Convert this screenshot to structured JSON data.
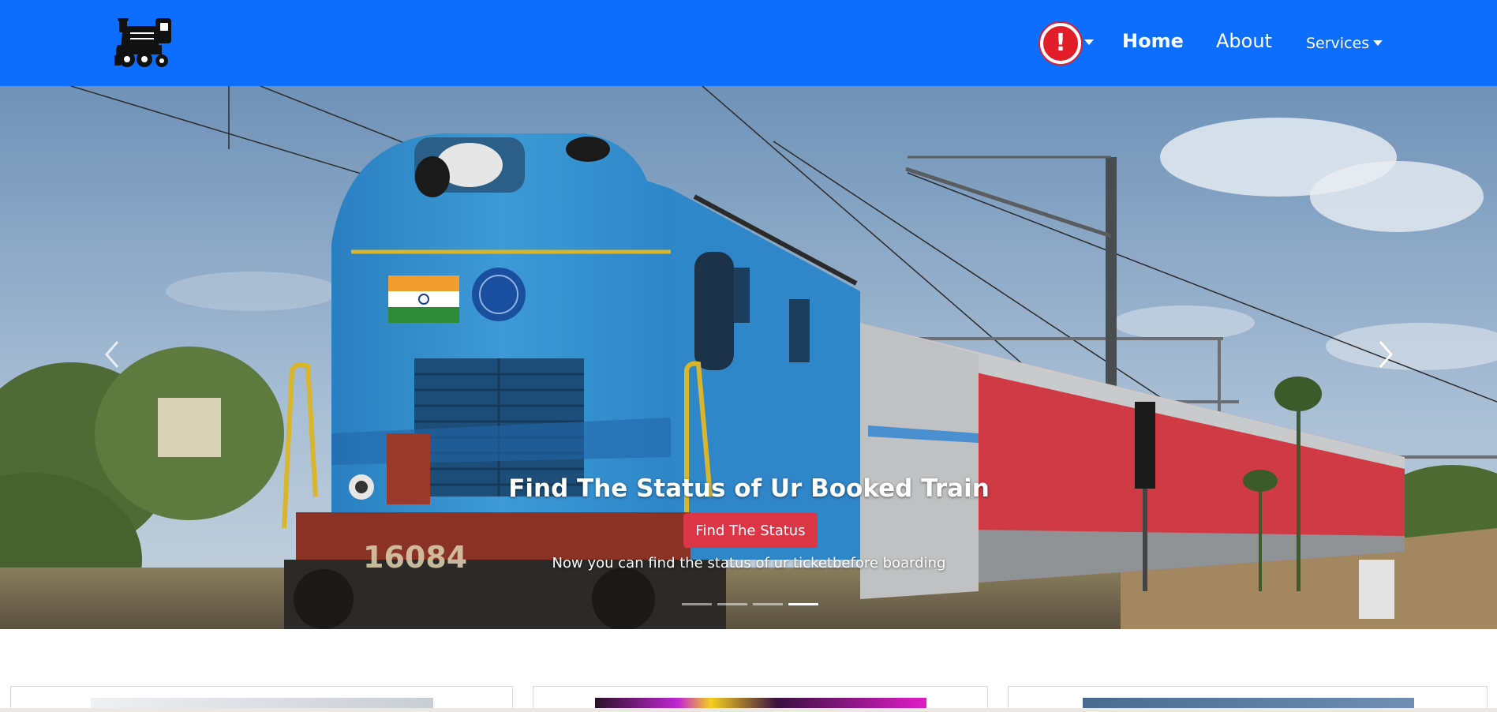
{
  "navbar": {
    "logo_icon": "steam-locomotive-logo",
    "alert_icon": "exclamation-alert-icon",
    "alert_symbol": "!",
    "home_label": "Home",
    "about_label": "About",
    "services_label": "Services",
    "background_color": "#0d6efd",
    "alert_color": "#e11d2a"
  },
  "carousel": {
    "slide_image": "blue diesel locomotive 16084 pulling red passenger coaches",
    "locomotive_number": "16084",
    "caption_title": "Find The Status of Ur Booked Train",
    "caption_button": "Find The Status",
    "caption_text": "Now you can find the status of ur ticketbefore boarding",
    "prev_icon": "chevron-left-icon",
    "next_icon": "chevron-right-icon",
    "slide_count": 4,
    "active_slide": 4,
    "button_color": "#dc3545"
  },
  "cards": [
    {
      "image_icon": "card-image"
    },
    {
      "image_icon": "card-image"
    },
    {
      "image_icon": "card-image"
    }
  ]
}
